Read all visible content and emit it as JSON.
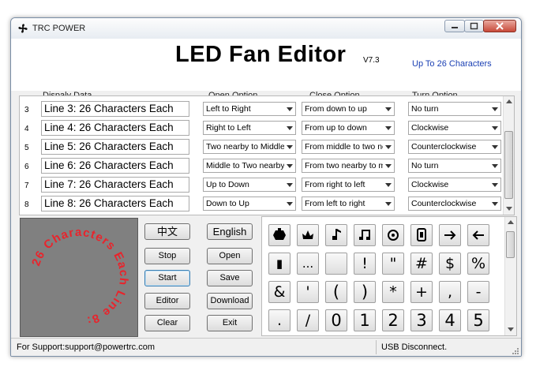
{
  "window": {
    "title": "TRC POWER",
    "header_title": "LED Fan Editor",
    "version": "V7.3",
    "chars_note": "Up To 26 Characters"
  },
  "columns": {
    "display": "Dispaly Data",
    "open": "Open Option",
    "close": "Close Option",
    "turn": "Turn Option"
  },
  "rows": [
    {
      "num": "3",
      "text": "Line 3: 26 Characters Each",
      "open": "Left to Right",
      "close": "From down to up",
      "turn": "No turn"
    },
    {
      "num": "4",
      "text": "Line 4: 26 Characters Each",
      "open": "Right to Left",
      "close": "From up to down",
      "turn": "Clockwise"
    },
    {
      "num": "5",
      "text": "Line 5: 26 Characters Each",
      "open": "Two nearby to Middle",
      "close": "From middle to two nearby",
      "turn": "Counterclockwise"
    },
    {
      "num": "6",
      "text": "Line 6: 26 Characters Each",
      "open": "Middle to Two nearby",
      "close": "From two nearby to middle",
      "turn": "No turn"
    },
    {
      "num": "7",
      "text": "Line 7: 26 Characters Each",
      "open": "Up to Down",
      "close": "From right to left",
      "turn": "Clockwise"
    },
    {
      "num": "8",
      "text": "Line 8: 26 Characters Each",
      "open": "Down to Up",
      "close": "From left to right",
      "turn": "Counterclockwise"
    }
  ],
  "preview": {
    "text": "26 Characters Each Line 8:",
    "color": "#e8242c"
  },
  "buttons": {
    "chinese": "中文",
    "english": "English",
    "stop": "Stop",
    "open": "Open",
    "start": "Start",
    "save": "Save",
    "editor": "Editor",
    "download": "Download",
    "clear": "Clear",
    "exit": "Exit"
  },
  "keypad": {
    "row1_icons": [
      "bug-icon",
      "crown-icon",
      "music-note-icon",
      "double-note-icon",
      "circle-dot-icon",
      "digital-zero-icon",
      "arrow-right-icon",
      "arrow-left-icon"
    ],
    "row2": [
      "▮",
      "...",
      "",
      "!",
      "\"",
      "#",
      "$",
      "%"
    ],
    "row3": [
      "&",
      "'",
      "(",
      ")",
      "*",
      "+",
      ",",
      "-"
    ],
    "row4": [
      ".",
      "/",
      "0",
      "1",
      "2",
      "3",
      "4",
      "5"
    ]
  },
  "status": {
    "support": "For Support:support@powertrc.com",
    "usb": "USB Disconnect."
  }
}
